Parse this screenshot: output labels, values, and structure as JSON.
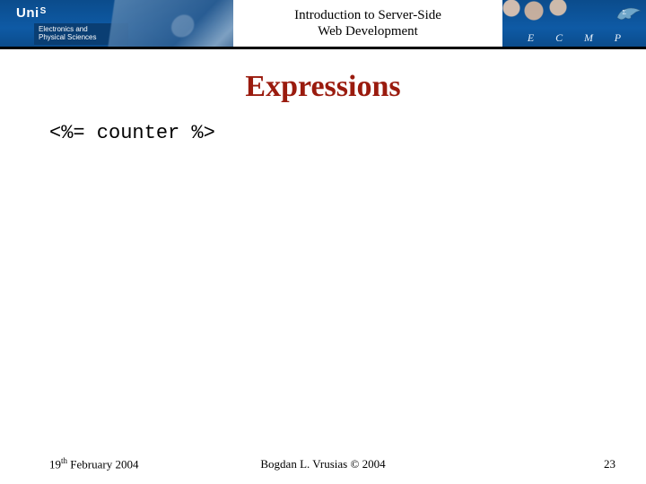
{
  "banner": {
    "uni_name": "Uni",
    "uni_suffix": "S",
    "dept_line1": "Electronics and",
    "dept_line2": "Physical Sciences",
    "course_title_line1": "Introduction to Server-Side",
    "course_title_line2": "Web Development",
    "letters": [
      "E",
      "C",
      "M",
      "P"
    ]
  },
  "slide": {
    "title": "Expressions",
    "code": "<%= counter %>"
  },
  "footer": {
    "date_day": "19",
    "date_ord": "th",
    "date_rest": " February 2004",
    "author": "Bogdan L. Vrusias © 2004",
    "page": "23"
  }
}
